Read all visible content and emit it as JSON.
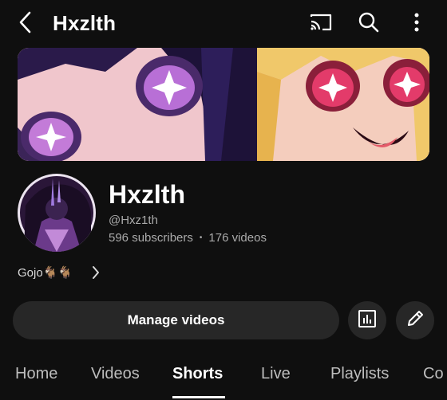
{
  "header": {
    "title": "Hxzlth",
    "back_icon": "chevron-left-icon",
    "cast_icon": "cast-icon",
    "search_icon": "search-icon",
    "more_icon": "more-vertical-icon"
  },
  "channel": {
    "name": "Hxzlth",
    "handle": "@Hxz1th",
    "subscribers": "596 subscribers",
    "separator": "•",
    "videos": "176 videos",
    "description": "Gojo🐐🐐"
  },
  "actions": {
    "manage_label": "Manage videos",
    "analytics_icon": "analytics-icon",
    "edit_icon": "pencil-icon"
  },
  "tabs": [
    {
      "label": "Home",
      "active": false
    },
    {
      "label": "Videos",
      "active": false
    },
    {
      "label": "Shorts",
      "active": true
    },
    {
      "label": "Live",
      "active": false
    },
    {
      "label": "Playlists",
      "active": false
    },
    {
      "label": "Co",
      "active": false
    }
  ],
  "colors": {
    "background": "#0f0f0f",
    "button_bg": "#272727",
    "secondary_text": "#aaaaaa",
    "active_tab": "#ffffff"
  }
}
